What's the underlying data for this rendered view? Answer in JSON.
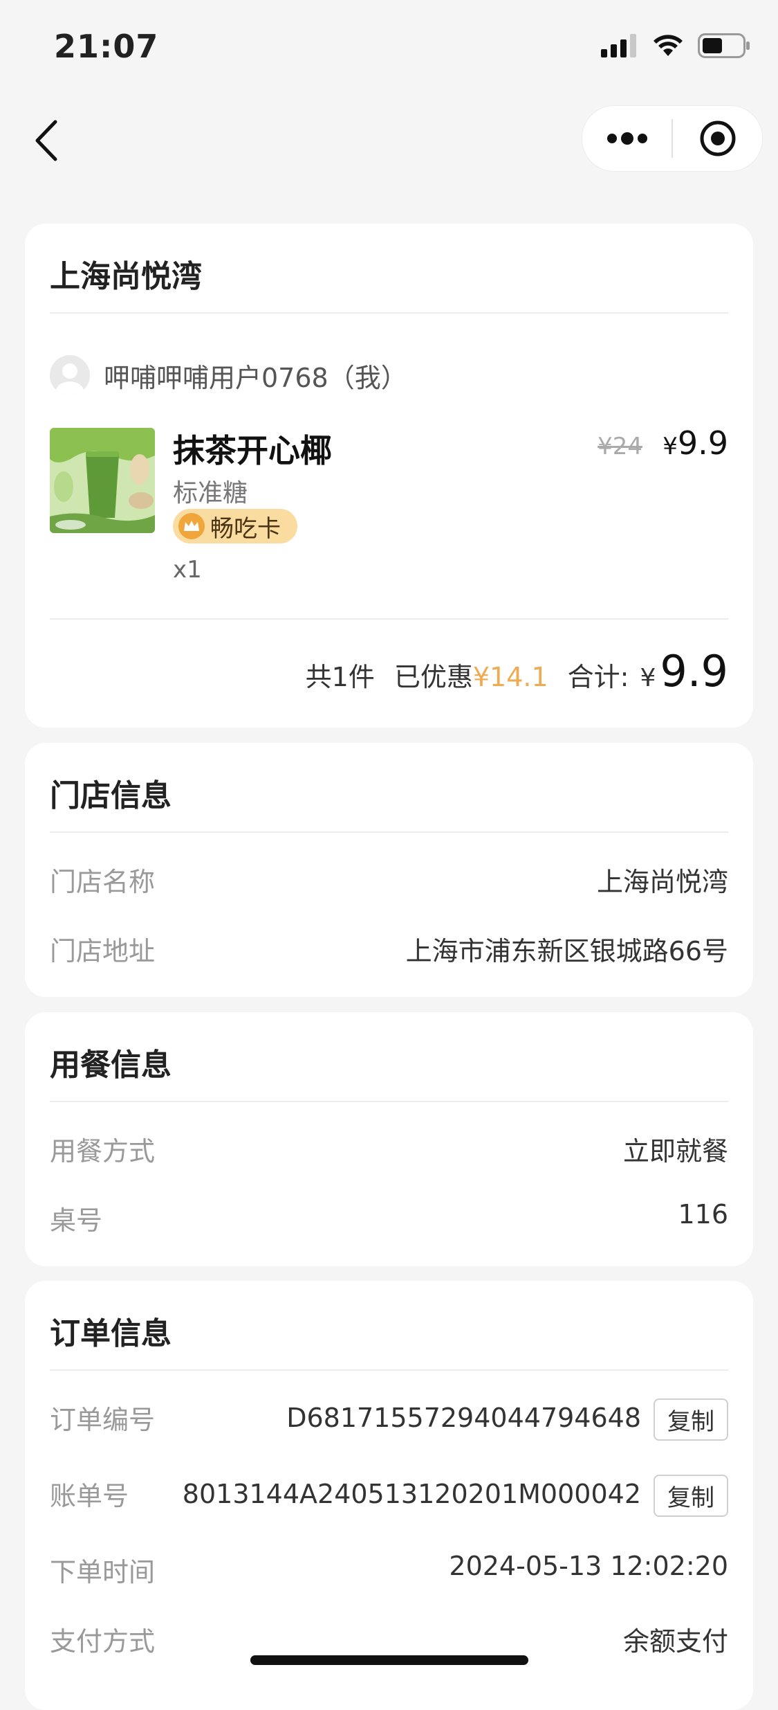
{
  "status_bar": {
    "time": "21:07"
  },
  "nav": {
    "back_icon": "chevron-left-icon",
    "more_icon": "more-dots-icon",
    "target_icon": "target-circle-icon"
  },
  "order_card": {
    "store_name": "上海尚悦湾",
    "user": "呷哺呷哺用户0768（我）",
    "item": {
      "name": "抹茶开心椰",
      "spec": "标准糖",
      "badge": "畅吃卡",
      "qty": "x1",
      "original_price": "¥24",
      "price_symbol": "¥",
      "price": "9.9"
    },
    "summary": {
      "count": "共1件",
      "discount_label": "已优惠",
      "discount_value": "¥14.1",
      "total_label": "合计:",
      "total_symbol": "¥",
      "total_value": "9.9"
    }
  },
  "store_info": {
    "title": "门店信息",
    "rows": [
      {
        "label": "门店名称",
        "value": "上海尚悦湾"
      },
      {
        "label": "门店地址",
        "value": "上海市浦东新区银城路66号"
      }
    ]
  },
  "dining_info": {
    "title": "用餐信息",
    "rows": [
      {
        "label": "用餐方式",
        "value": "立即就餐"
      },
      {
        "label": "桌号",
        "value": "116"
      }
    ]
  },
  "order_info": {
    "title": "订单信息",
    "copy_label": "复制",
    "rows": [
      {
        "label": "订单编号",
        "value": "D68171557294044794648"
      },
      {
        "label": "账单号",
        "value": "8013144A240513120201M000042"
      },
      {
        "label": "下单时间",
        "value": "2024-05-13 12:02:20"
      },
      {
        "label": "支付方式",
        "value": "余额支付"
      }
    ]
  },
  "colors": {
    "accent_discount": "#f0ab52",
    "badge_bg": "#fbdca0",
    "page_bg": "#f5f5f5"
  }
}
